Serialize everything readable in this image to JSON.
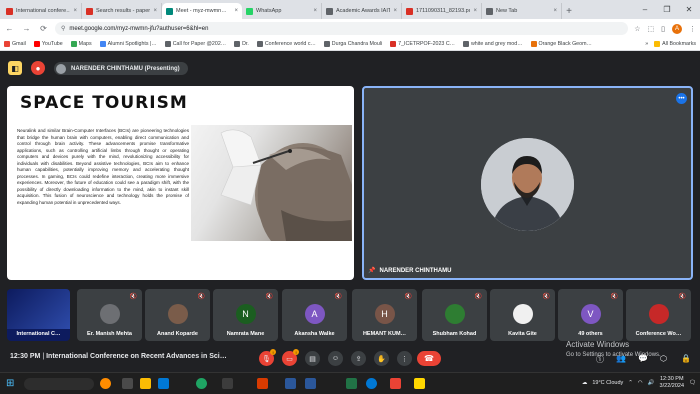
{
  "browser": {
    "tabs": [
      {
        "label": "International confere…",
        "color": "#d93025",
        "active": false
      },
      {
        "label": "Search results - papers…",
        "color": "#d93025",
        "active": false
      },
      {
        "label": "Meet - myz-mwmn…",
        "color": "#00897b",
        "active": true
      },
      {
        "label": "WhatsApp",
        "color": "#25d366",
        "active": false
      },
      {
        "label": "Academic Awards IAIT…",
        "color": "#5f6368",
        "active": false
      },
      {
        "label": "1711090311_82193.pdf",
        "color": "#d93025",
        "active": false
      },
      {
        "label": "New Tab",
        "color": "#5f6368",
        "active": false
      }
    ],
    "url": "meet.google.com/myz-mwmn-jfu?authuser=6&hl=en",
    "profile_initial": "A",
    "bookmarks": [
      {
        "label": "Gmail",
        "color": "#ea4335"
      },
      {
        "label": "YouTube",
        "color": "#ff0000"
      },
      {
        "label": "Maps",
        "color": "#34a853"
      },
      {
        "label": "Alumni Spotlights |…",
        "color": "#4285f4"
      },
      {
        "label": "Call for Paper @202…",
        "color": "#5f6368"
      },
      {
        "label": "Dr.",
        "color": "#5f6368"
      },
      {
        "label": "Conference world c…",
        "color": "#5f6368"
      },
      {
        "label": "Durga Chandra Mouli",
        "color": "#5f6368"
      },
      {
        "label": "7_ICETRPOF-2023 C…",
        "color": "#d93025"
      },
      {
        "label": "white and grey mod…",
        "color": "#5f6368"
      },
      {
        "label": "Orange Black Geom…",
        "color": "#e8710a"
      }
    ],
    "all_bookmarks": "All Bookmarks"
  },
  "meet": {
    "presenter_chip": "NARENDER CHINTHAMU (Presenting)",
    "slide": {
      "title": "SPACE TOURISM",
      "body": "Neuralink and similar Brain-Computer Interfaces (BCIs) are pioneering technologies that bridge the human brain with computers, enabling direct communication and control through brain activity. These advancements promise transformative applications, such as controlling artificial limbs through thought or operating computers and devices purely with the mind, revolutionizing accessibility for individuals with disabilities. Beyond assistive technologies, BCIs aim to enhance human capabilities, potentially improving memory and accelerating thought processes. In gaming, BCIs could redefine interaction, creating more immersive experiences. Moreover, the future of education could see a paradigm shift, with the possibility of directly downloading information to the mind, akin to instant skill acquisition. This fusion of neuroscience and technology holds the promise of expanding human potential in unprecedented ways."
    },
    "speaker_name": "NARENDER CHINTHAMU",
    "participants": [
      {
        "name": "International C…",
        "initial": "",
        "color": "#1a237e"
      },
      {
        "name": "Er. Manish Mehta",
        "initial": "",
        "color": "#6d6f73"
      },
      {
        "name": "Anand Koparde",
        "initial": "",
        "color": "#7a5c4a"
      },
      {
        "name": "Namrata Mane",
        "initial": "N",
        "color": "#1b5e20"
      },
      {
        "name": "Akansha Walke",
        "initial": "A",
        "color": "#7e57c2"
      },
      {
        "name": "HEMANT KUM…",
        "initial": "H",
        "color": "#795548"
      },
      {
        "name": "Shubham Kohad",
        "initial": "",
        "color": "#2e7d32"
      },
      {
        "name": "Kavita Gite",
        "initial": "",
        "color": "#f0f0f0"
      },
      {
        "name": "49 others",
        "initial": "V",
        "color": "#7e57c2"
      },
      {
        "name": "Conference Wo…",
        "initial": "",
        "color": "#c62828"
      }
    ],
    "bottom": {
      "time": "12:30 PM",
      "separator": "|",
      "meeting_title": "International Conference on Recent Advances in Sci…"
    },
    "windows_notice": {
      "line1": "Activate Windows",
      "line2": "Go to Settings to activate Windows."
    }
  },
  "taskbar": {
    "weather": "19°C  Cloudy",
    "time": "12:30 PM",
    "date": "3/22/2024"
  }
}
